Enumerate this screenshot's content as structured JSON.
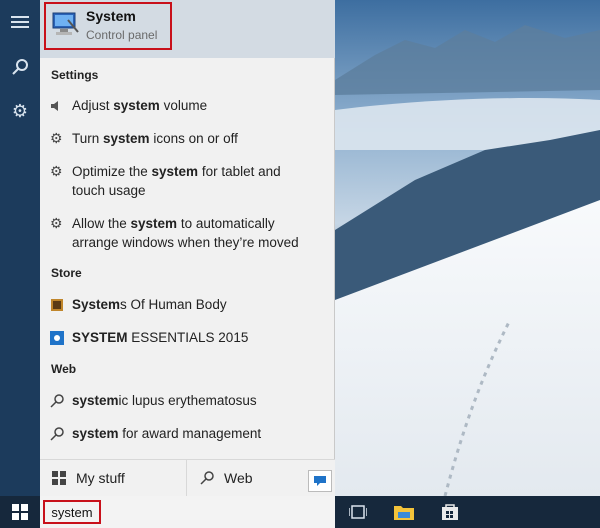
{
  "top_result": {
    "title": "System",
    "subtitle": "Control panel"
  },
  "settings": {
    "heading": "Settings",
    "items": [
      {
        "icon": "speaker-icon",
        "pre": "Adjust ",
        "bold": "system",
        "post": " volume"
      },
      {
        "icon": "gear-icon",
        "pre": "Turn ",
        "bold": "system",
        "post": " icons on or off"
      },
      {
        "icon": "gear-icon",
        "pre": "Optimize the ",
        "bold": "system",
        "post": " for tablet and touch usage"
      },
      {
        "icon": "gear-icon",
        "pre": "Allow the ",
        "bold": "system",
        "post": " to automatically arrange windows when they’re moved"
      }
    ]
  },
  "store": {
    "heading": "Store",
    "items": [
      {
        "icon": "book-icon",
        "pre": "",
        "bold": "System",
        "post": "s Of Human Body"
      },
      {
        "icon": "app-icon",
        "pre": "",
        "bold": "SYSTEM",
        "post": " ESSENTIALS 2015"
      }
    ]
  },
  "web": {
    "heading": "Web",
    "items": [
      {
        "icon": "search-icon",
        "pre": "",
        "bold": "system",
        "post": "ic lupus erythematosus"
      },
      {
        "icon": "search-icon",
        "pre": "",
        "bold": "system",
        "post": " for award management"
      }
    ]
  },
  "bottom": {
    "my_stuff": "My stuff",
    "web": "Web"
  },
  "taskbar": {
    "query": "system"
  }
}
